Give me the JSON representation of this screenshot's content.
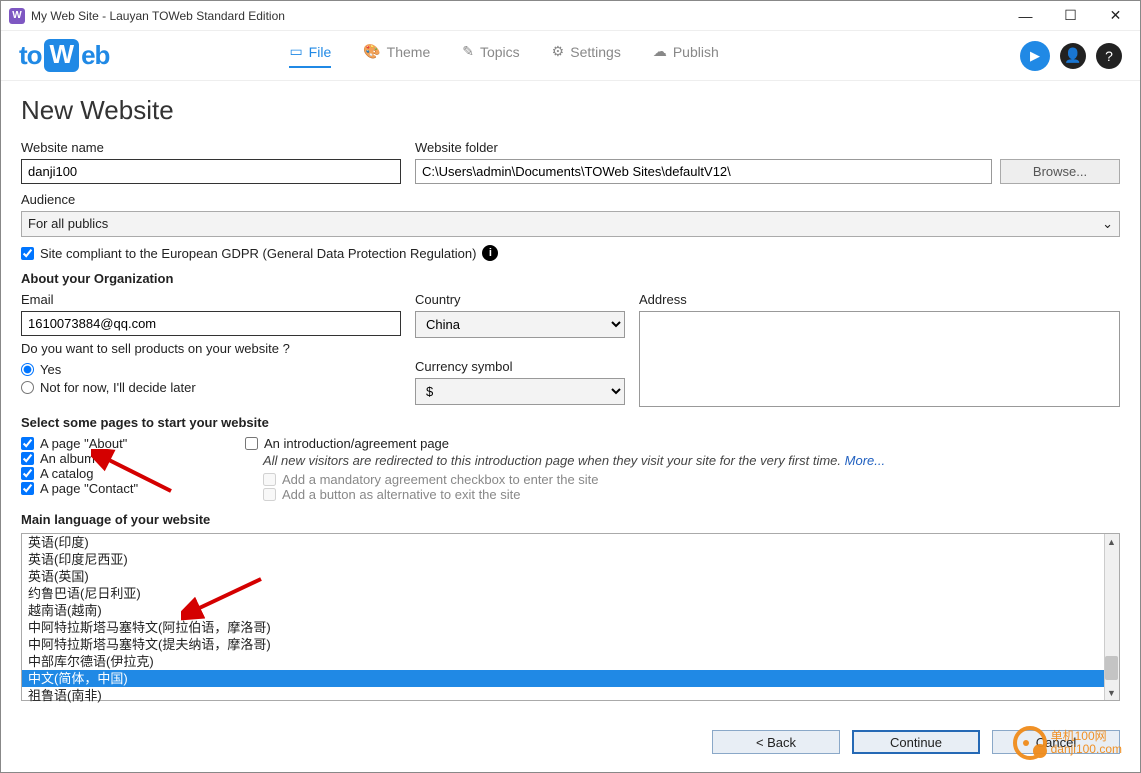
{
  "window": {
    "title": "My Web Site - Lauyan TOWeb Standard Edition"
  },
  "logo": {
    "prefix": "to",
    "mid": "W",
    "suffix": "eb"
  },
  "tabs": {
    "file": "File",
    "theme": "Theme",
    "topics": "Topics",
    "settings": "Settings",
    "publish": "Publish"
  },
  "page": {
    "heading": "New Website"
  },
  "fields": {
    "website_name_label": "Website name",
    "website_name_value": "danji100",
    "website_folder_label": "Website folder",
    "website_folder_value": "C:\\Users\\admin\\Documents\\TOWeb Sites\\defaultV12\\",
    "browse_btn": "Browse...",
    "audience_label": "Audience",
    "audience_value": "For all publics",
    "gdpr_label": "Site compliant to the European GDPR (General Data Protection Regulation)"
  },
  "org": {
    "heading": "About your Organization",
    "email_label": "Email",
    "email_value": "1610073884@qq.com",
    "country_label": "Country",
    "country_value": "China",
    "address_label": "Address",
    "sell_q": "Do you want to sell products on your website ?",
    "yes": "Yes",
    "later": "Not for now, I'll decide later",
    "currency_label": "Currency symbol",
    "currency_value": "$"
  },
  "pages": {
    "heading": "Select some pages to start your website",
    "about": "A page \"About\"",
    "album": "An album",
    "catalog": "A catalog",
    "contact": "A page \"Contact\"",
    "intro": "An introduction/agreement page",
    "intro_hint": "All new visitors are redirected to this introduction page when they visit your site for the very first time. ",
    "more": "More...",
    "mandatory": "Add a mandatory agreement checkbox to enter the site",
    "exitbtn": "Add a button as alternative to exit the site"
  },
  "lang": {
    "heading": "Main language of your website",
    "items": [
      {
        "label": "英语(印度)",
        "sel": false
      },
      {
        "label": "英语(印度尼西亚)",
        "sel": false
      },
      {
        "label": "英语(英国)",
        "sel": false
      },
      {
        "label": "约鲁巴语(尼日利亚)",
        "sel": false
      },
      {
        "label": "越南语(越南)",
        "sel": false
      },
      {
        "label": "中阿特拉斯塔马塞特文(阿拉伯语，摩洛哥)",
        "sel": false
      },
      {
        "label": "中阿特拉斯塔马塞特文(提夫纳语，摩洛哥)",
        "sel": false
      },
      {
        "label": "中部库尔德语(伊拉克)",
        "sel": false
      },
      {
        "label": "中文(简体，中国)",
        "sel": true
      },
      {
        "label": "祖鲁语(南非)",
        "sel": false
      }
    ]
  },
  "nav": {
    "back": "<  Back",
    "continue": "Continue",
    "cancel": "Cancel"
  },
  "watermark": {
    "line1": "单机100网",
    "line2": "danji100.com"
  }
}
